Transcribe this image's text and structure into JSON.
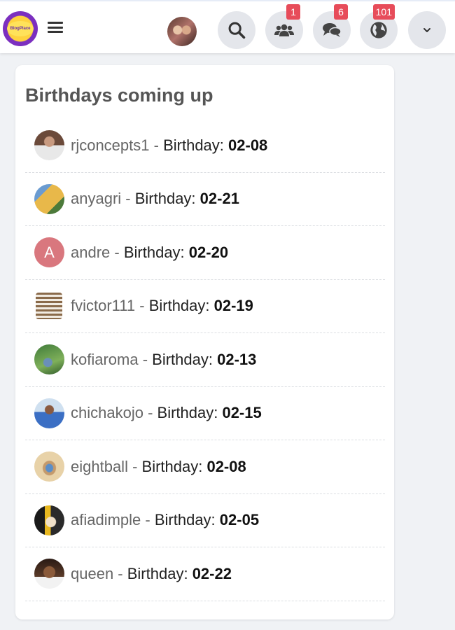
{
  "header": {
    "logo_text": "BlogPlace",
    "badges": {
      "friends": "1",
      "messages": "6",
      "notifications": "101"
    }
  },
  "widget": {
    "title": "Birthdays coming up",
    "separator": " - ",
    "birthday_label": "Birthday: ",
    "items": [
      {
        "username": "rjconcepts1",
        "date": "02-08"
      },
      {
        "username": "anyagri",
        "date": "02-21"
      },
      {
        "username": "andre",
        "date": "02-20",
        "initial": "A"
      },
      {
        "username": "fvictor111",
        "date": "02-19"
      },
      {
        "username": "kofiaroma",
        "date": "02-13"
      },
      {
        "username": "chichakojo",
        "date": "02-15"
      },
      {
        "username": "eightball",
        "date": "02-08"
      },
      {
        "username": "afiadimple",
        "date": "02-05"
      },
      {
        "username": "queen",
        "date": "02-22"
      }
    ]
  },
  "colors": {
    "badge": "#e74c5a",
    "icon_button_bg": "#e4e6eb",
    "initial_avatar_bg": "#d9777e"
  }
}
